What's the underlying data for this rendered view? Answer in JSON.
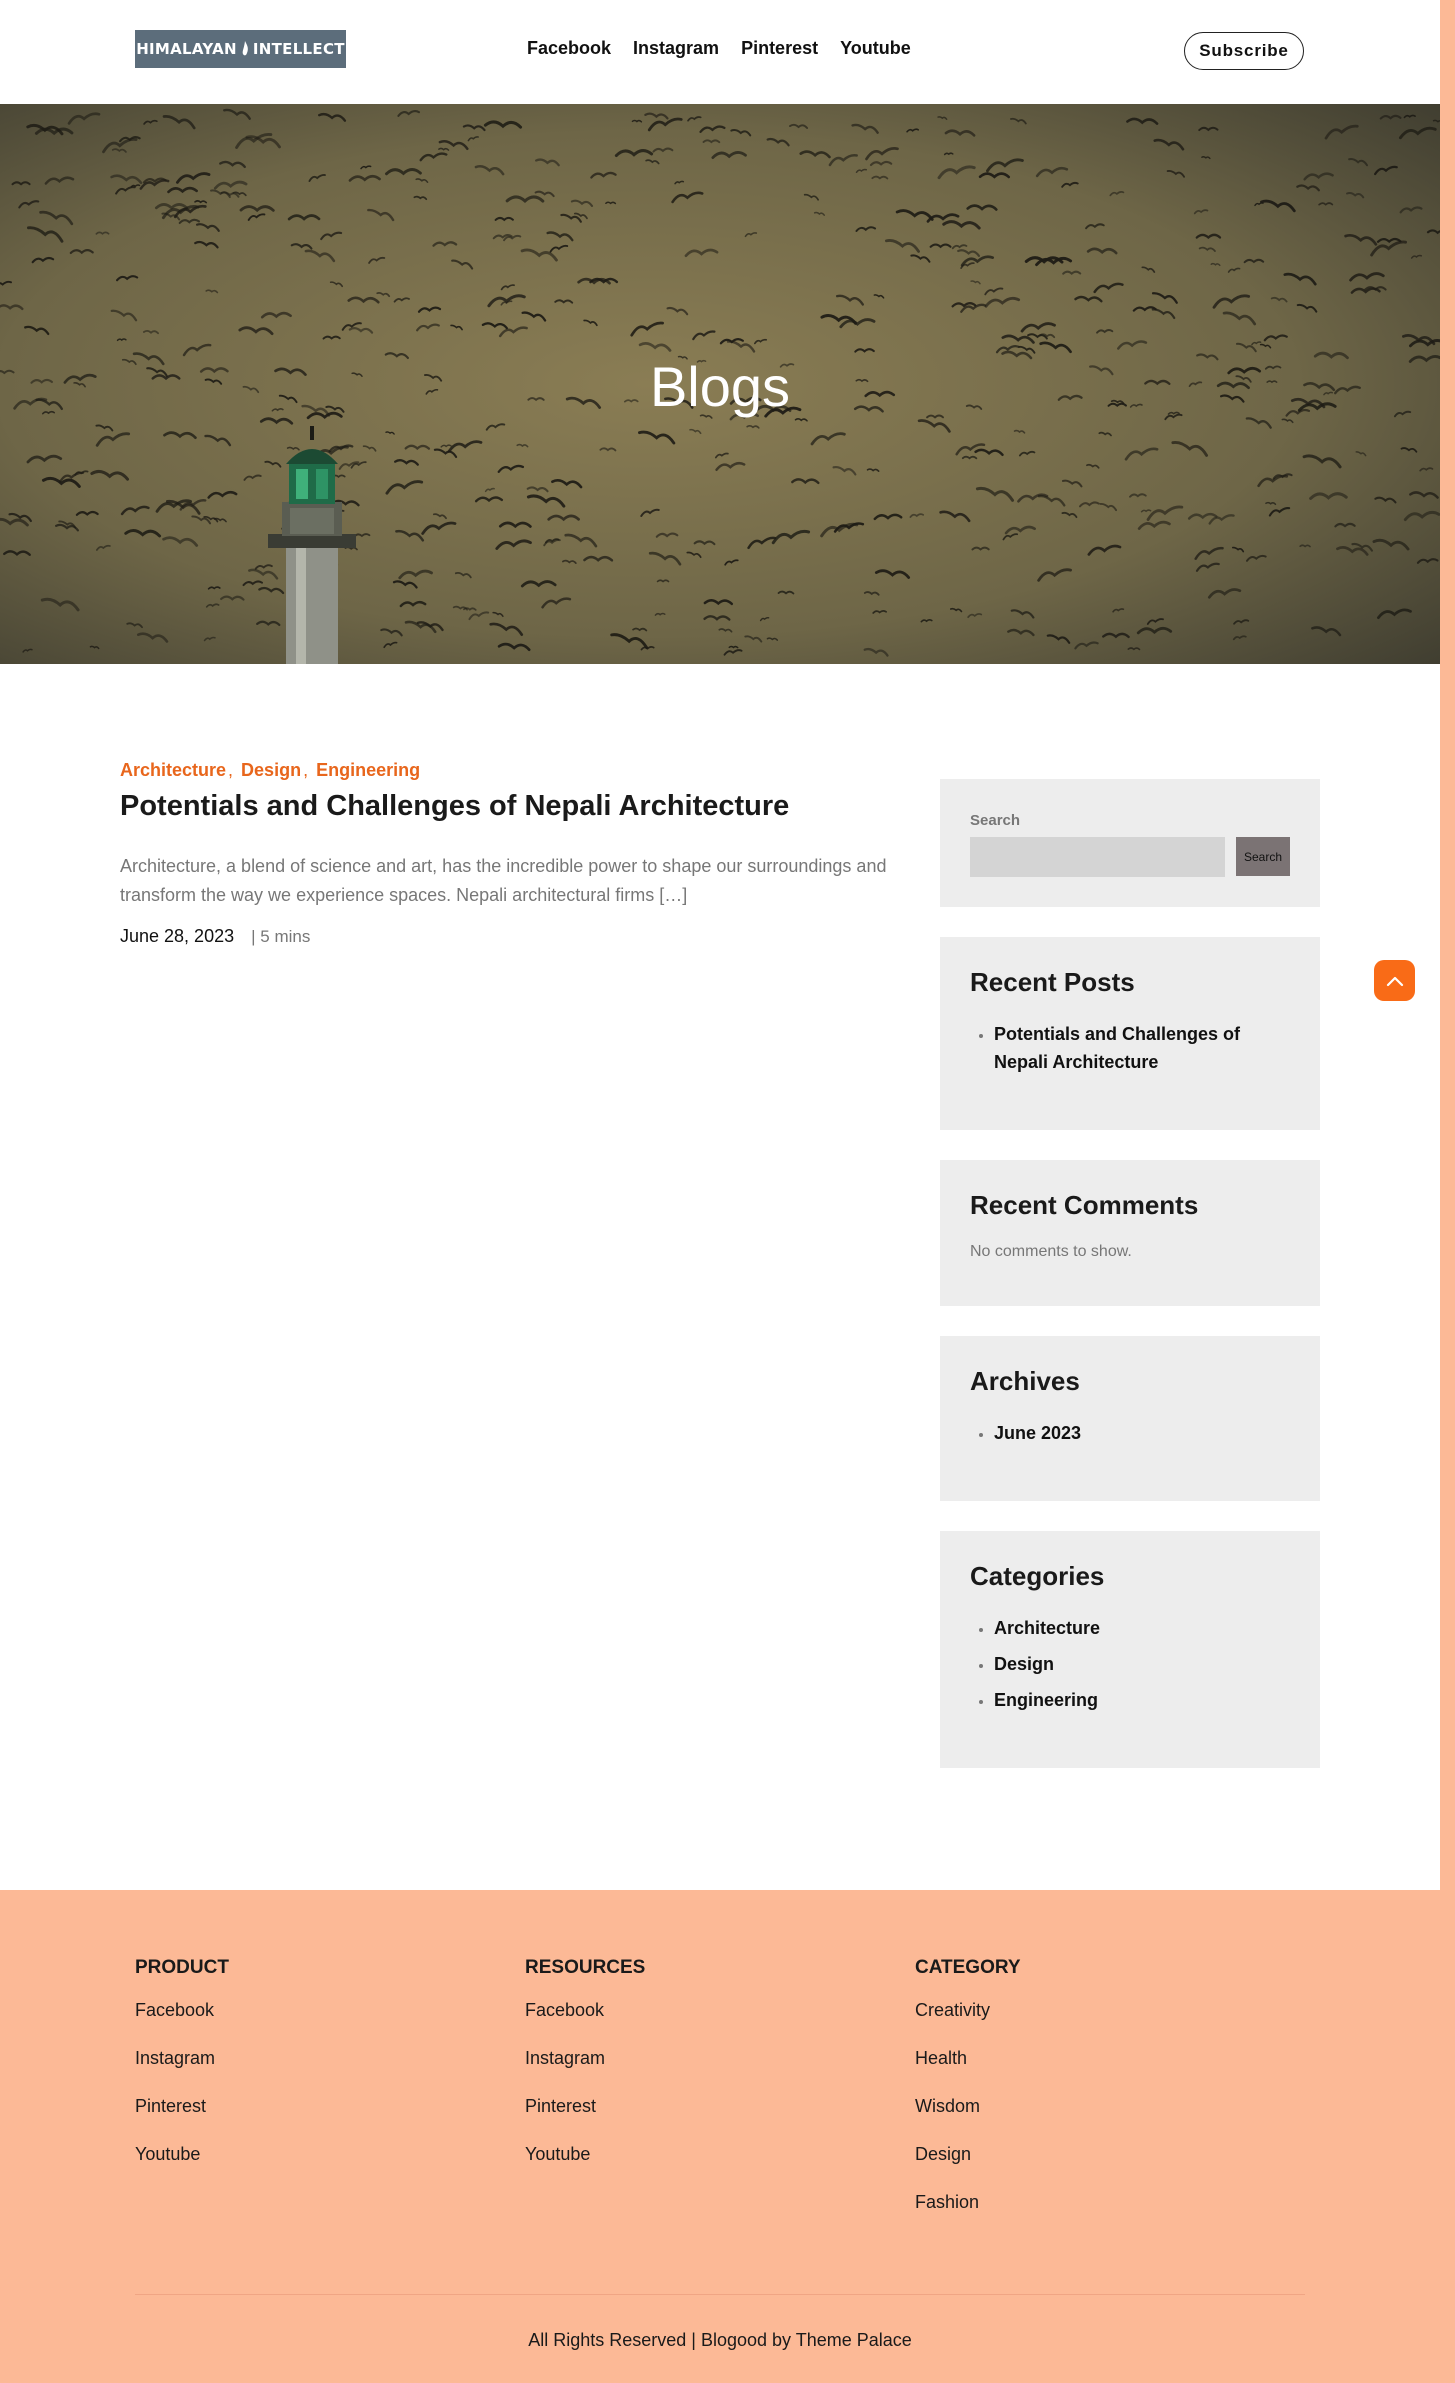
{
  "header": {
    "logo": {
      "left": "HIMALAYAN",
      "right": "INTELLECT"
    },
    "nav": [
      "Facebook",
      "Instagram",
      "Pinterest",
      "Youtube"
    ],
    "subscribe_label": "Subscribe"
  },
  "hero": {
    "title": "Blogs"
  },
  "post": {
    "categories": [
      "Architecture",
      "Design",
      "Engineering"
    ],
    "title": "Potentials and Challenges of Nepali Architecture",
    "excerpt": "Architecture, a blend of science and art, has the incredible power to shape our surroundings and transform the way we experience spaces. Nepali architectural firms […]",
    "date": "June 28, 2023",
    "read_time": "| 5 mins"
  },
  "sidebar": {
    "search": {
      "label": "Search",
      "button_label": "Search",
      "value": ""
    },
    "recent_posts": {
      "title": "Recent Posts",
      "items": [
        "Potentials and Challenges of Nepali Architecture"
      ]
    },
    "recent_comments": {
      "title": "Recent Comments",
      "empty_text": "No comments to show."
    },
    "archives": {
      "title": "Archives",
      "items": [
        "June 2023"
      ]
    },
    "categories": {
      "title": "Categories",
      "items": [
        "Architecture",
        "Design",
        "Engineering"
      ]
    }
  },
  "footer": {
    "columns": [
      {
        "title": "PRODUCT",
        "links": [
          "Facebook",
          "Instagram",
          "Pinterest",
          "Youtube"
        ]
      },
      {
        "title": "RESOURCES",
        "links": [
          "Facebook",
          "Instagram",
          "Pinterest",
          "Youtube"
        ]
      },
      {
        "title": "CATEGORY",
        "links": [
          "Creativity",
          "Health",
          "Wisdom",
          "Design",
          "Fashion"
        ]
      }
    ],
    "copyright": "All Rights Reserved | Blogood by Theme Palace"
  },
  "colors": {
    "accent": "#e8661c",
    "scroll_top": "#f96b17",
    "footer_bg": "#fcb996",
    "widget_bg": "#ededed",
    "logo_bg": "#5c6d7b"
  },
  "icons": {
    "scroll_top": "chevron-up-icon",
    "logo_mark": "flame-icon"
  }
}
